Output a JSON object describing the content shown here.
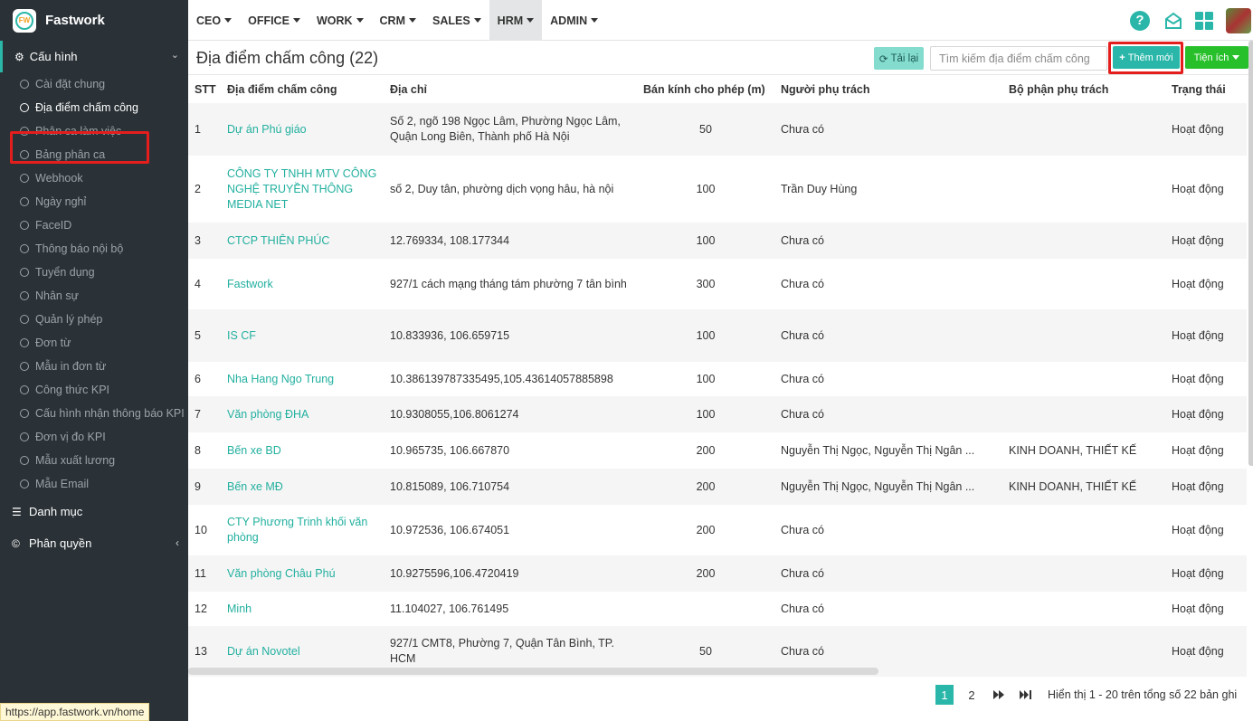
{
  "brand": {
    "name": "Fastwork",
    "logo_text": "FW"
  },
  "topnav": [
    "CEO",
    "OFFICE",
    "WORK",
    "CRM",
    "SALES",
    "HRM",
    "ADMIN"
  ],
  "topnav_active": "HRM",
  "sidebar": {
    "header": "Cấu hình",
    "items": [
      "Cài đặt chung",
      "Địa điểm chấm công",
      "Phân ca làm việc",
      "Bảng phân ca",
      "Webhook",
      "Ngày nghỉ",
      "FaceID",
      "Thông báo nội bộ",
      "Tuyển dụng",
      "Nhân sự",
      "Quản lý phép",
      "Đơn từ",
      "Mẫu in đơn từ",
      "Công thức KPI",
      "Cấu hình nhận thông báo KPI",
      "Đơn vị đo KPI",
      "Mẫu xuất lương",
      "Mẫu Email"
    ],
    "active_index": 1,
    "sections": [
      "Danh mục",
      "Phân quyền"
    ]
  },
  "page": {
    "title": "Địa điểm chấm công (22)",
    "reload_label": "Tải lại",
    "search_placeholder": "Tìm kiếm địa điểm chấm công",
    "add_label": "Thêm mới",
    "util_label": "Tiện ích"
  },
  "table": {
    "columns": [
      "STT",
      "Địa điểm chấm công",
      "Địa chỉ",
      "Bán kính cho phép (m)",
      "Người phụ trách",
      "Bộ phận phụ trách",
      "Trạng thái"
    ],
    "rows": [
      [
        "1",
        "Dự án Phú giáo",
        "Số 2, ngõ 198 Ngọc Lâm, Phường Ngọc Lâm, Quận Long Biên, Thành phố Hà Nội",
        "50",
        "Chưa có",
        "",
        "Hoạt động"
      ],
      [
        "2",
        "CÔNG TY TNHH MTV CÔNG NGHỆ TRUYỀN THÔNG MEDIA NET",
        "số 2, Duy tân, phường dịch vọng hâu, hà nội",
        "100",
        "Trần Duy Hùng",
        "",
        "Hoạt động"
      ],
      [
        "3",
        "CTCP THIÊN PHÚC",
        "12.769334, 108.177344",
        "100",
        "Chưa có",
        "",
        "Hoạt động"
      ],
      [
        "4",
        "Fastwork",
        "927/1 cách mạng tháng tám phường 7 tân bình",
        "300",
        "Chưa có",
        "",
        "Hoạt động"
      ],
      [
        "5",
        "IS CF",
        "10.833936, 106.659715",
        "100",
        "Chưa có",
        "",
        "Hoạt động"
      ],
      [
        "6",
        "Nha Hang Ngo Trung",
        "10.386139787335495,105.43614057885898",
        "100",
        "Chưa có",
        "",
        "Hoạt động"
      ],
      [
        "7",
        "Văn phòng ĐHA",
        "10.9308055,106.8061274",
        "100",
        "Chưa có",
        "",
        "Hoạt động"
      ],
      [
        "8",
        "Bến xe BD",
        "10.965735, 106.667870",
        "200",
        "Nguyễn Thị Ngọc, Nguyễn Thị Ngân ...",
        "KINH DOANH, THIẾT KẾ",
        "Hoạt động"
      ],
      [
        "9",
        "Bến xe MĐ",
        "10.815089, 106.710754",
        "200",
        "Nguyễn Thị Ngọc, Nguyễn Thị Ngân ...",
        "KINH DOANH, THIẾT KẾ",
        "Hoạt động"
      ],
      [
        "10",
        "CTY Phương Trinh khối văn phòng",
        "10.972536, 106.674051",
        "200",
        "Chưa có",
        "",
        "Hoạt động"
      ],
      [
        "11",
        "Văn phòng Châu Phú",
        "10.9275596,106.4720419",
        "200",
        "Chưa có",
        "",
        "Hoạt động"
      ],
      [
        "12",
        "Minh",
        "11.104027, 106.761495",
        "",
        "Chưa có",
        "",
        "Hoạt động"
      ],
      [
        "13",
        "Dự án Novotel",
        "927/1 CMT8, Phường 7, Quận Tân Bình, TP. HCM",
        "50",
        "Chưa có",
        "",
        "Hoạt động"
      ]
    ]
  },
  "pagination": {
    "pages": [
      "1",
      "2"
    ],
    "active": "1",
    "next": "⏵⏵",
    "last": "⏭",
    "info": "Hiển thị 1 - 20 trên tổng số 22 bản ghi"
  },
  "status_url": "https://app.fastwork.vn/home",
  "colors": {
    "accent": "#2ab7a9",
    "sidebar_bg": "#2b3237",
    "highlight": "#e41d1d",
    "util_green": "#28c02a"
  }
}
